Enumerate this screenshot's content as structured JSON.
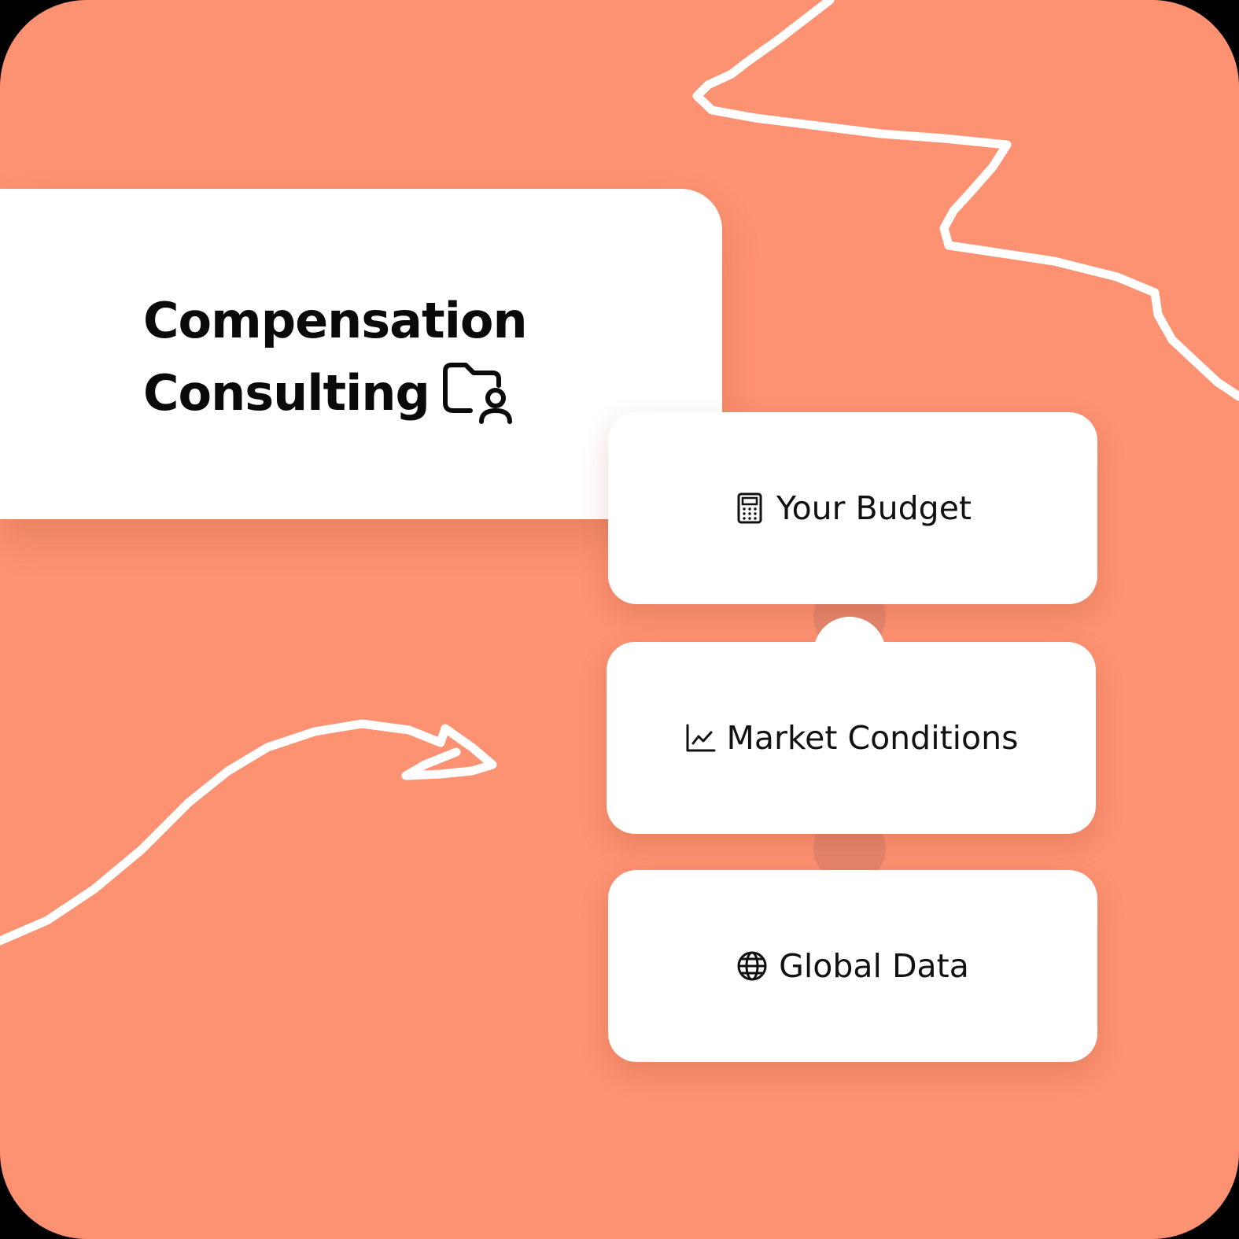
{
  "background_color": "#FD9272",
  "card_color": "#FFFFFF",
  "connector_color": "#E5866D",
  "title": {
    "line1": "Compensation",
    "line2": "Consulting",
    "icon": "folder-user-icon"
  },
  "steps": [
    {
      "label": "Your Budget",
      "icon": "calculator-icon"
    },
    {
      "label": "Market Conditions",
      "icon": "line-chart-icon"
    },
    {
      "label": "Global Data",
      "icon": "globe-icon"
    }
  ]
}
